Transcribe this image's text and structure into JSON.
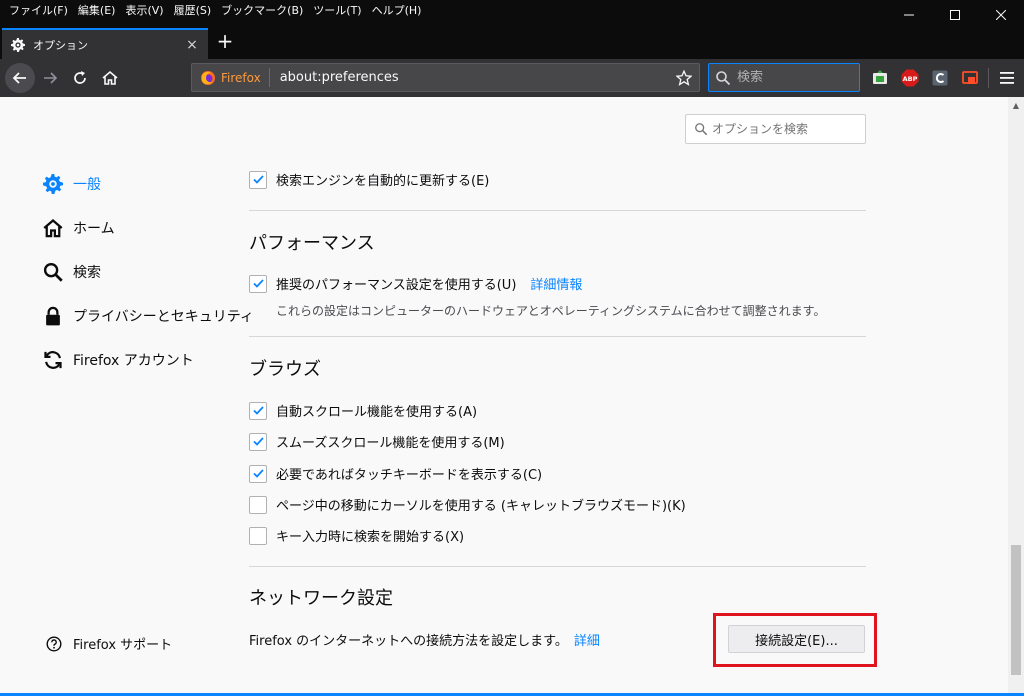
{
  "menubar": {
    "items": [
      "ファイル(F)",
      "編集(E)",
      "表示(V)",
      "履歴(S)",
      "ブックマーク(B)",
      "ツール(T)",
      "ヘルプ(H)"
    ]
  },
  "window_controls": {
    "minimize": "—",
    "maximize": "☐",
    "close": "✕"
  },
  "tab": {
    "title": "オプション",
    "close": "×",
    "new_tab": "+"
  },
  "navbar": {
    "identity_label": "Firefox",
    "url": "about:preferences",
    "search_placeholder": "検索",
    "extensions": [
      "screenshot-extension",
      "adblock-plus",
      "extension-c",
      "extension-red"
    ]
  },
  "preferences_search": {
    "placeholder": "オプションを検索"
  },
  "sidebar": {
    "items": [
      {
        "label": "一般",
        "icon": "gear-icon",
        "selected": true
      },
      {
        "label": "ホーム",
        "icon": "home-icon",
        "selected": false
      },
      {
        "label": "検索",
        "icon": "search-icon",
        "selected": false
      },
      {
        "label": "プライバシーとセキュリティ",
        "icon": "lock-icon",
        "selected": false
      },
      {
        "label": "Firefox アカウント",
        "icon": "sync-icon",
        "selected": false
      }
    ],
    "support_label": "Firefox サポート"
  },
  "main": {
    "search_engine_update": {
      "label": "検索エンジンを自動的に更新する(E)",
      "checked": true
    },
    "performance": {
      "heading": "パフォーマンス",
      "recommended": {
        "label": "推奨のパフォーマンス設定を使用する(U)",
        "checked": true
      },
      "learn_more": "詳細情報",
      "description": "これらの設定はコンピューターのハードウェアとオペレーティングシステムに合わせて調整されます。"
    },
    "browsing": {
      "heading": "ブラウズ",
      "options": [
        {
          "label": "自動スクロール機能を使用する(A)",
          "checked": true
        },
        {
          "label": "スムーズスクロール機能を使用する(M)",
          "checked": true
        },
        {
          "label": "必要であればタッチキーボードを表示する(C)",
          "checked": true
        },
        {
          "label": "ページ中の移動にカーソルを使用する (キャレットブラウズモード)(K)",
          "checked": false
        },
        {
          "label": "キー入力時に検索を開始する(X)",
          "checked": false
        }
      ]
    },
    "network": {
      "heading": "ネットワーク設定",
      "description": "Firefox のインターネットへの接続方法を設定します。",
      "learn_more": "詳細",
      "button": "接続設定(E)..."
    }
  },
  "colors": {
    "accent": "#0a84ff",
    "highlight_box": "#e0141e",
    "chrome_dark": "#0c0c0d",
    "toolbar": "#323234"
  }
}
